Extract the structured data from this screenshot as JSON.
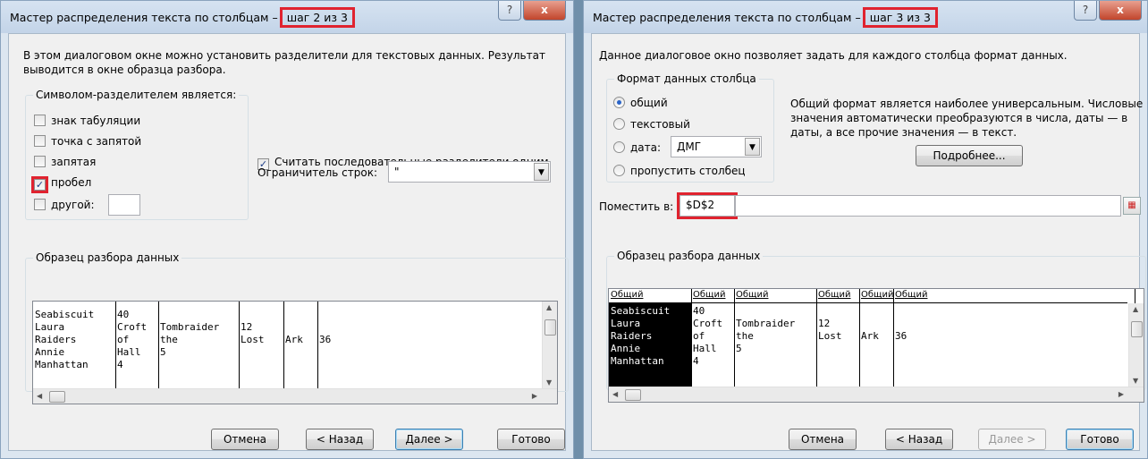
{
  "dialog1": {
    "title_prefix": "Мастер распределения текста по столбцам –",
    "title_step": "шаг 2 из 3",
    "help_label": "?",
    "close_label": "x",
    "description": "В этом диалоговом окне можно установить разделители для текстовых данных. Результат выводится в окне образца разбора.",
    "delimiters_group": "Символом-разделителем является:",
    "delimiters": [
      {
        "label": "знак табуляции",
        "checked": false
      },
      {
        "label": "точка с запятой",
        "checked": false
      },
      {
        "label": "запятая",
        "checked": false
      },
      {
        "label": "пробел",
        "checked": true
      },
      {
        "label": "другой:",
        "checked": false
      }
    ],
    "consecutive_label": "Считать последовательные разделители одним",
    "consecutive_checked": true,
    "qualifier_label": "Ограничитель строк:",
    "qualifier_value": "\"",
    "preview_label": "Образец разбора данных",
    "preview_rows": [
      [
        "Seabiscuit",
        "40",
        "",
        "",
        "",
        ""
      ],
      [
        "Laura",
        "Croft",
        "Tombraider",
        "12",
        "",
        ""
      ],
      [
        "Raiders",
        "of",
        "the",
        "Lost",
        "Ark",
        "36"
      ],
      [
        "Annie",
        "Hall",
        "5",
        "",
        "",
        ""
      ],
      [
        "Manhattan",
        "4",
        "",
        "",
        "",
        ""
      ]
    ],
    "buttons": {
      "cancel": "Отмена",
      "back": "< Назад",
      "next": "Далее >",
      "finish": "Готово"
    }
  },
  "dialog2": {
    "title_prefix": "Мастер распределения текста по столбцам –",
    "title_step": "шаг 3 из 3",
    "help_label": "?",
    "close_label": "x",
    "description": "Данное диалоговое окно позволяет задать для каждого столбца формат данных.",
    "format_group": "Формат данных столбца",
    "formats": [
      {
        "label": "общий",
        "selected": true
      },
      {
        "label": "текстовый",
        "selected": false
      },
      {
        "label": "дата:",
        "selected": false
      },
      {
        "label": "пропустить столбец",
        "selected": false
      }
    ],
    "date_format": "ДМГ",
    "info_text": "Общий формат является наиболее универсальным. Числовые значения автоматически преобразуются в числа, даты — в даты, а все прочие значения — в текст.",
    "details_button": "Подробнее...",
    "destination_label": "Поместить в:",
    "destination_value": "$D$2",
    "preview_label": "Образец разбора данных",
    "column_headers": [
      "Общий",
      "Общий",
      "Общий",
      "Общий",
      "Общий",
      "Общий"
    ],
    "preview_rows": [
      [
        "Seabiscuit",
        "40",
        "",
        "",
        "",
        ""
      ],
      [
        "Laura",
        "Croft",
        "Tombraider",
        "12",
        "",
        ""
      ],
      [
        "Raiders",
        "of",
        "the",
        "Lost",
        "Ark",
        "36"
      ],
      [
        "Annie",
        "Hall",
        "5",
        "",
        "",
        ""
      ],
      [
        "Manhattan",
        "4",
        "",
        "",
        "",
        ""
      ]
    ],
    "buttons": {
      "cancel": "Отмена",
      "back": "< Назад",
      "next": "Далее >",
      "finish": "Готово"
    }
  }
}
